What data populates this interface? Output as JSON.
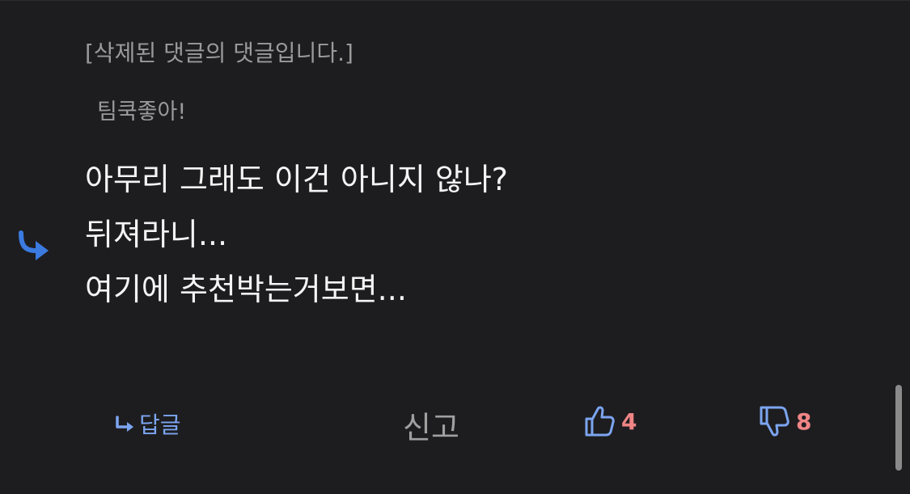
{
  "comment": {
    "deleted_notice": "[삭제된 댓글의 댓글입니다.]",
    "author": "팀쿡좋아!",
    "lines": [
      "아무리 그래도 이건 아니지 않나?",
      "뒤져라니...",
      "여기에 추천박는거보면..."
    ],
    "reply_icon": "reply-arrow-icon"
  },
  "actions": {
    "reply_label": "답글",
    "report_label": "신고",
    "like_count": "4",
    "dislike_count": "8"
  },
  "colors": {
    "background": "#1d1d20",
    "accent_blue": "#3b7be0",
    "count_red": "#f08585",
    "muted_text": "#9a9a9a"
  }
}
